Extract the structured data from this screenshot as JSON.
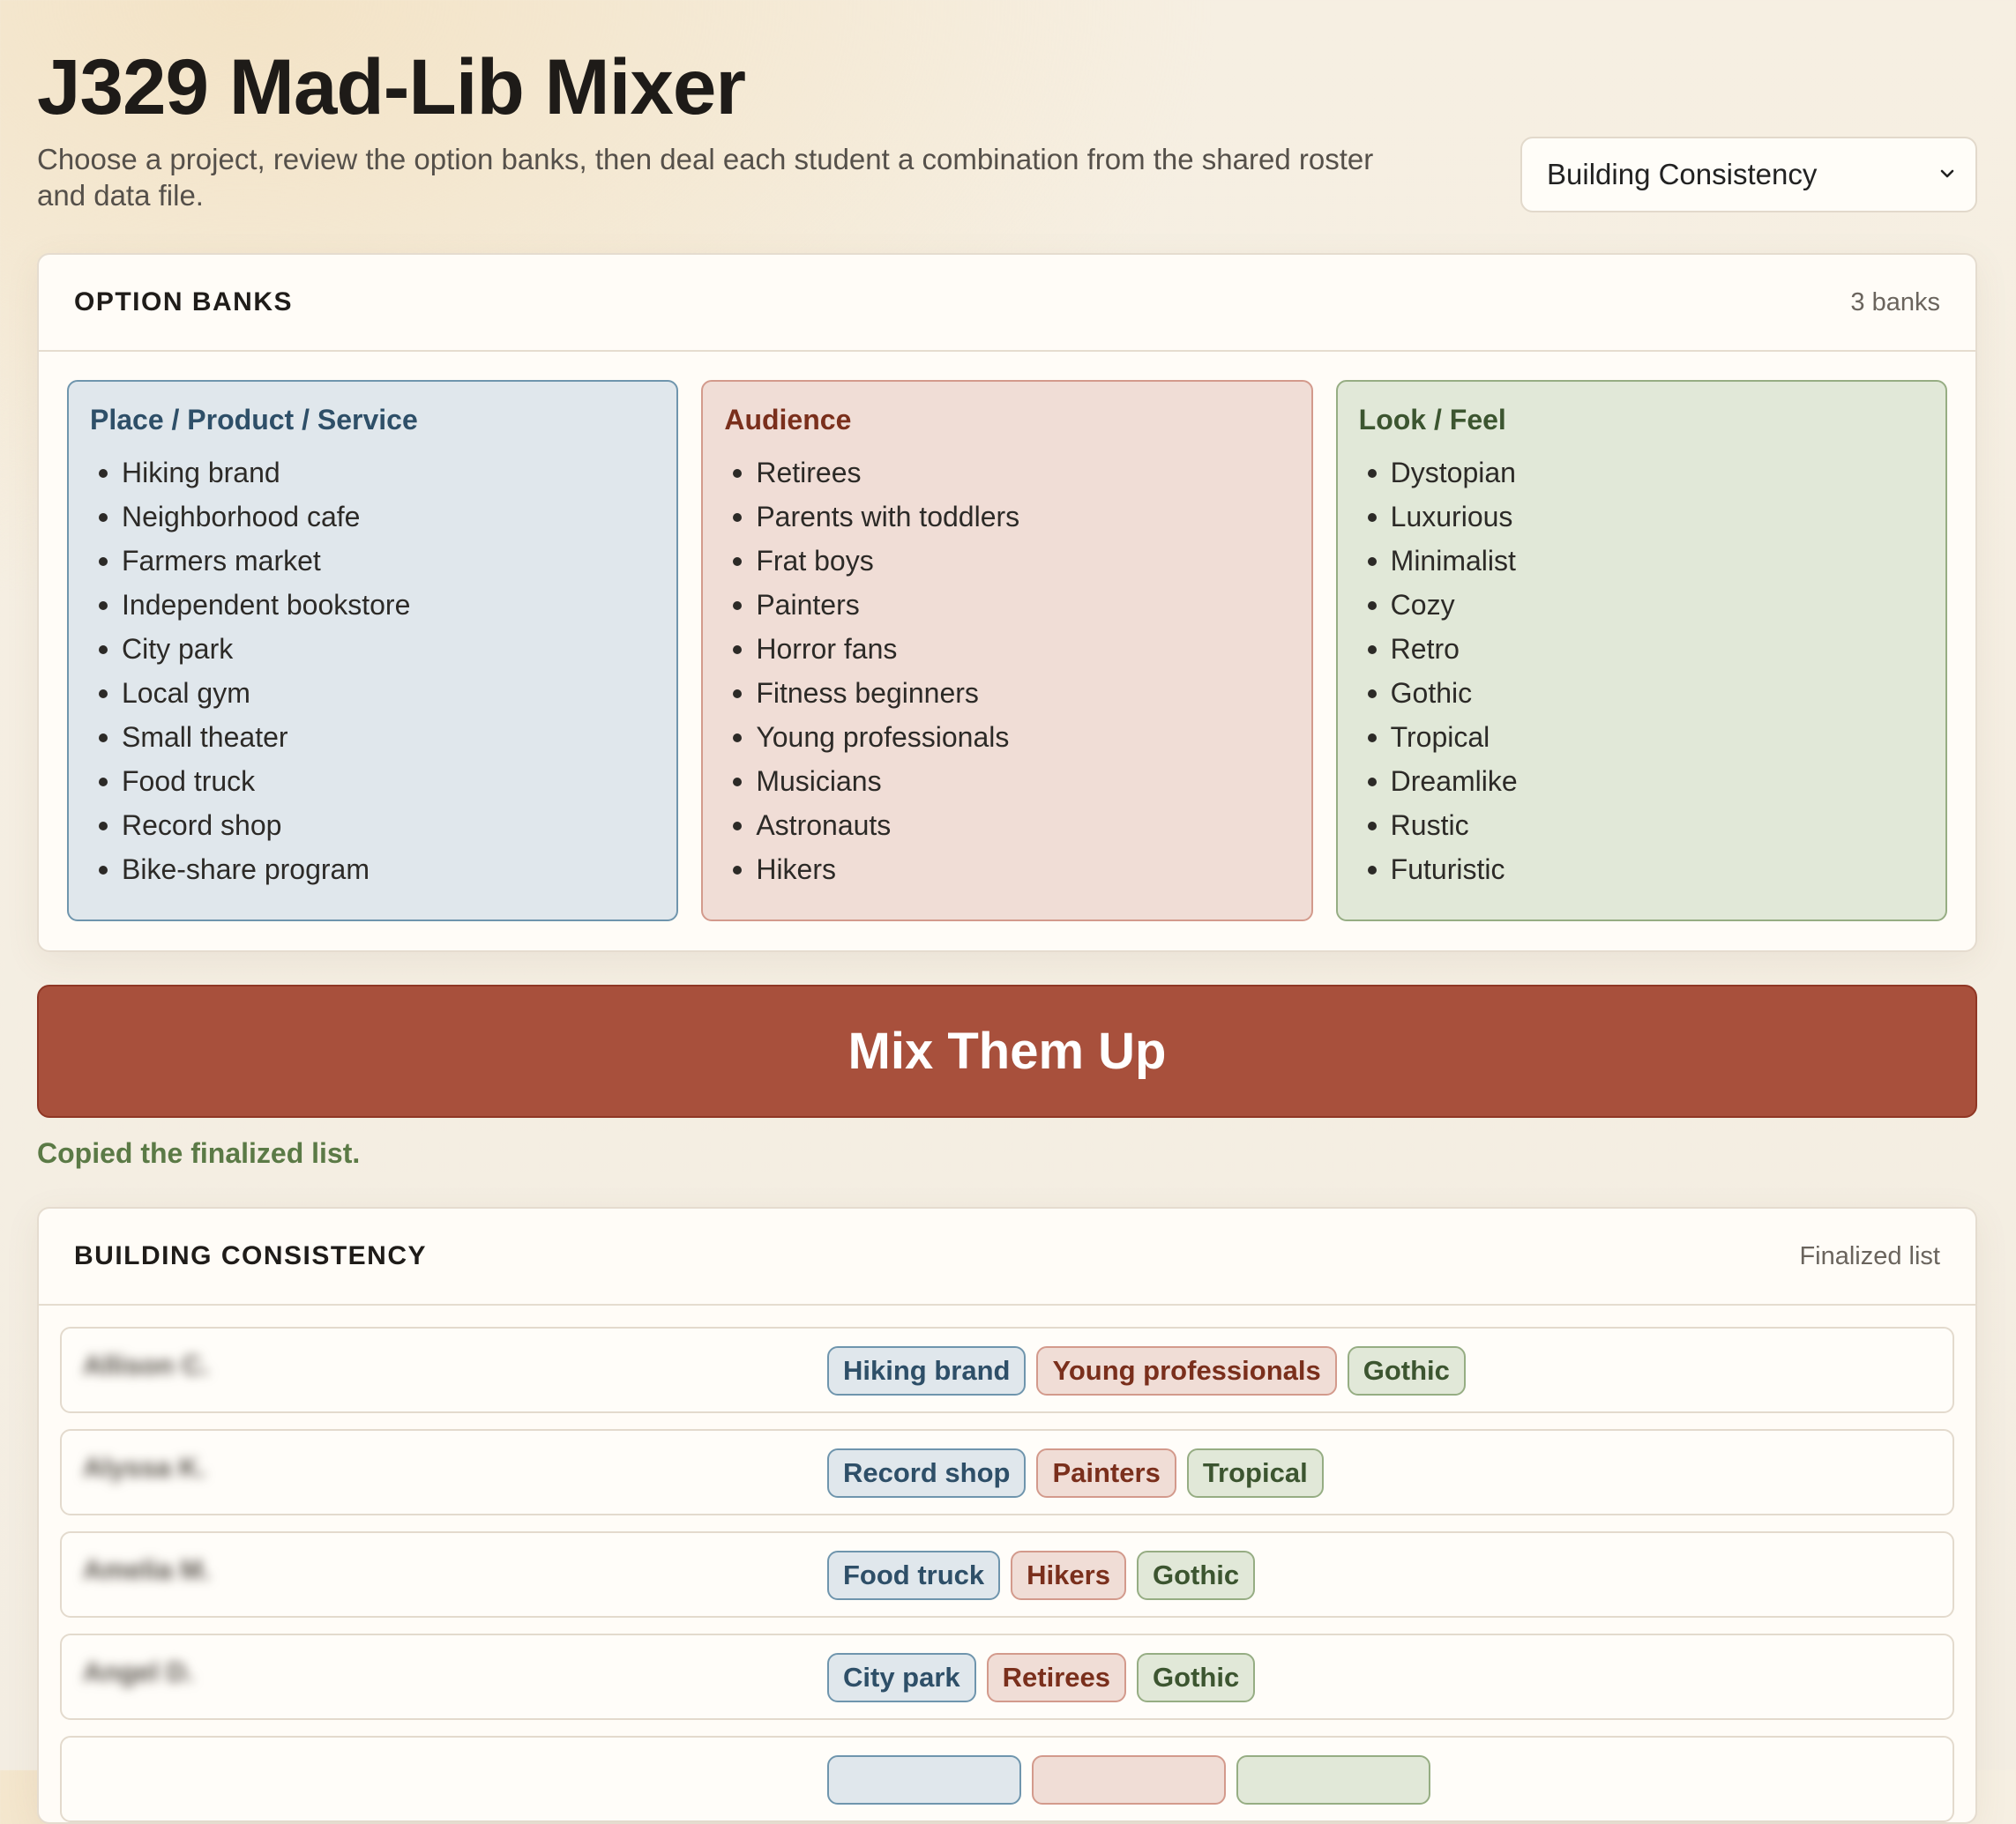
{
  "header": {
    "title": "J329 Mad-Lib Mixer",
    "subtitle": "Choose a project, review the option banks, then deal each student a combination from the shared roster and data file.",
    "project_select": {
      "value": "Building Consistency",
      "icon": "chevron-down-icon"
    }
  },
  "option_banks": {
    "title": "OPTION BANKS",
    "count_label": "3 banks",
    "banks": [
      {
        "title": "Place / Product / Service",
        "color": "#2e4f68",
        "items": [
          "Hiking brand",
          "Neighborhood cafe",
          "Farmers market",
          "Independent bookstore",
          "City park",
          "Local gym",
          "Small theater",
          "Food truck",
          "Record shop",
          "Bike-share program"
        ]
      },
      {
        "title": "Audience",
        "color": "#7a2f1c",
        "items": [
          "Retirees",
          "Parents with toddlers",
          "Frat boys",
          "Painters",
          "Horror fans",
          "Fitness beginners",
          "Young professionals",
          "Musicians",
          "Astronauts",
          "Hikers"
        ]
      },
      {
        "title": "Look / Feel",
        "color": "#3c5530",
        "items": [
          "Dystopian",
          "Luxurious",
          "Minimalist",
          "Cozy",
          "Retro",
          "Gothic",
          "Tropical",
          "Dreamlike",
          "Rustic",
          "Futuristic"
        ]
      }
    ]
  },
  "mix_button": {
    "label": "Mix Them Up",
    "color": "#a8503c"
  },
  "status": {
    "message": "Copied the finalized list.",
    "color": "#5b7a46"
  },
  "results": {
    "title": "BUILDING CONSISTENCY",
    "meta": "Finalized list",
    "rows": [
      {
        "student": "Allison C.",
        "place": "Hiking brand",
        "audience": "Young professionals",
        "look": "Gothic"
      },
      {
        "student": "Alyssa K.",
        "place": "Record shop",
        "audience": "Painters",
        "look": "Tropical"
      },
      {
        "student": "Amelia M.",
        "place": "Food truck",
        "audience": "Hikers",
        "look": "Gothic"
      },
      {
        "student": "Angel D.",
        "place": "City park",
        "audience": "Retirees",
        "look": "Gothic"
      },
      {
        "student": "",
        "place": "",
        "audience": "",
        "look": ""
      }
    ]
  }
}
